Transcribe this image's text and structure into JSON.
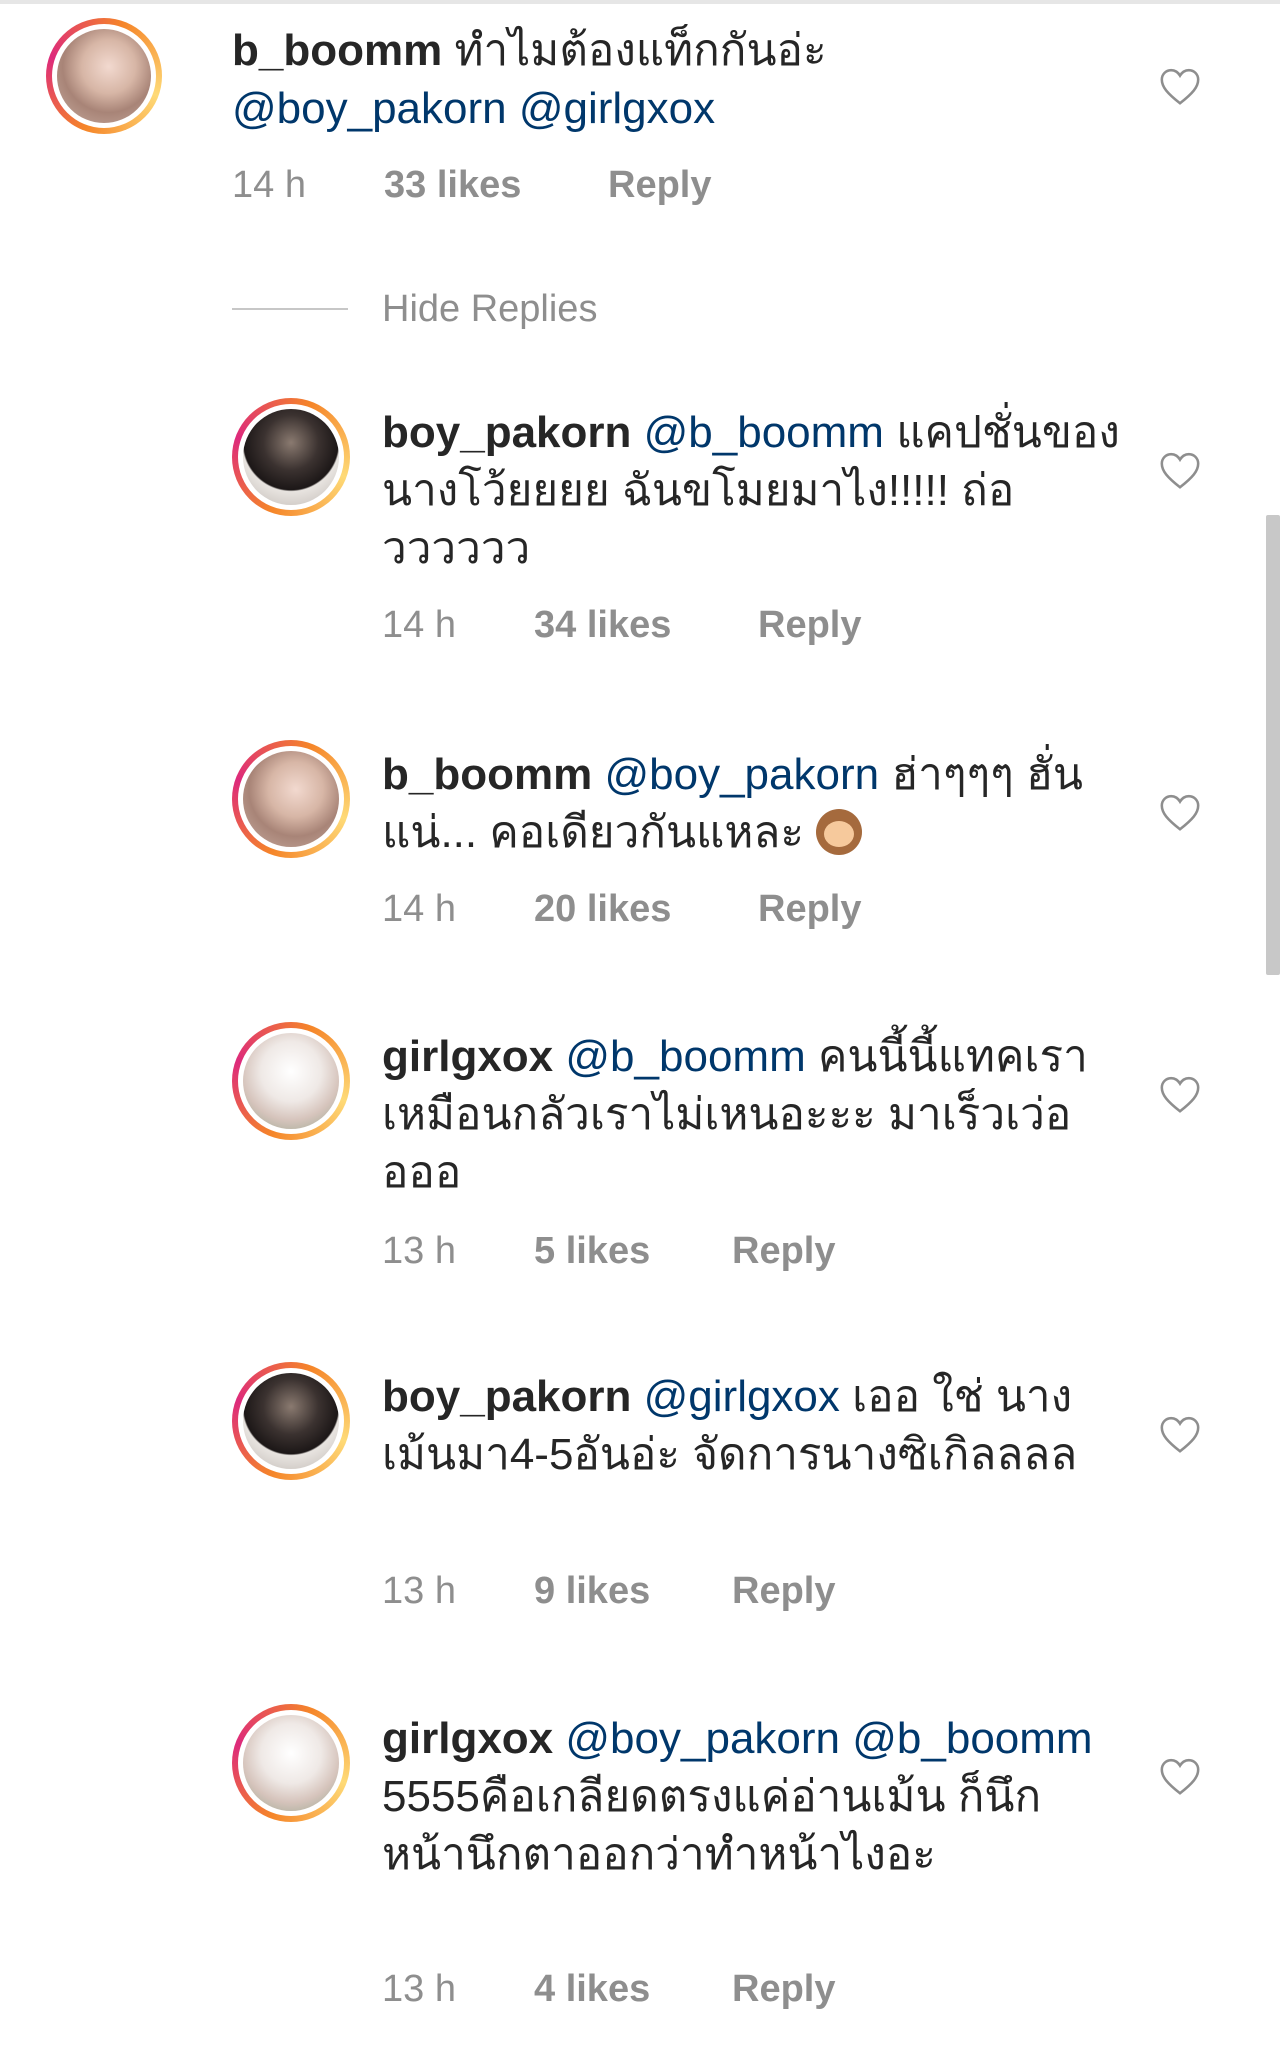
{
  "comments": [
    {
      "username": "b_boomm",
      "mentions_prefix": "",
      "text_line1": "ทำไมต้องแท็กกันอ่ะ",
      "mentions": "@boy_pakorn @girlgxox",
      "time": "14 h",
      "likes": "33 likes",
      "reply": "Reply"
    },
    {
      "username": "boy_pakorn",
      "mention": "@b_boomm",
      "text": "แคปชั่นของนางโว้ยยยย ฉันขโมยมาไง!!!!! ถ่อวววววว",
      "time": "14 h",
      "likes": "34 likes",
      "reply": "Reply"
    },
    {
      "username": "b_boomm",
      "mention": "@boy_pakorn",
      "text": "ฮ่าๆๆๆ ฮั่นแน่... คอเดียวกันแหละ",
      "emoji": "see-no-evil-monkey",
      "time": "14 h",
      "likes": "20 likes",
      "reply": "Reply"
    },
    {
      "username": "girlgxox",
      "mention": "@b_boomm",
      "text": "คนนี้นี้แทคเรา เหมือนกลัวเราไม่เหนอะะะ มาเร็วเว่ออออ",
      "time": "13 h",
      "likes": "5 likes",
      "reply": "Reply"
    },
    {
      "username": "boy_pakorn",
      "mention": "@girlgxox",
      "text": "เออ ใช่ นางเม้นมา4-5อันอ่ะ จัดการนางซิเกิลลลล",
      "time": "13 h",
      "likes": "9 likes",
      "reply": "Reply"
    },
    {
      "username": "girlgxox",
      "mention": "@boy_pakorn",
      "mention2": "@b_boomm",
      "text": "5555คือเกลียดตรงแค่อ่านเม้น ก็นึกหน้านึกตาออกว่าทำหน้าไงอะ",
      "time": "13 h",
      "likes": "4 likes",
      "reply": "Reply"
    }
  ],
  "hide_replies": "Hide Replies",
  "icons": {
    "like": "heart-outline-icon"
  },
  "colors": {
    "mention": "#00376b",
    "meta": "#8e8e8e",
    "ring": "#dd2a7b"
  }
}
